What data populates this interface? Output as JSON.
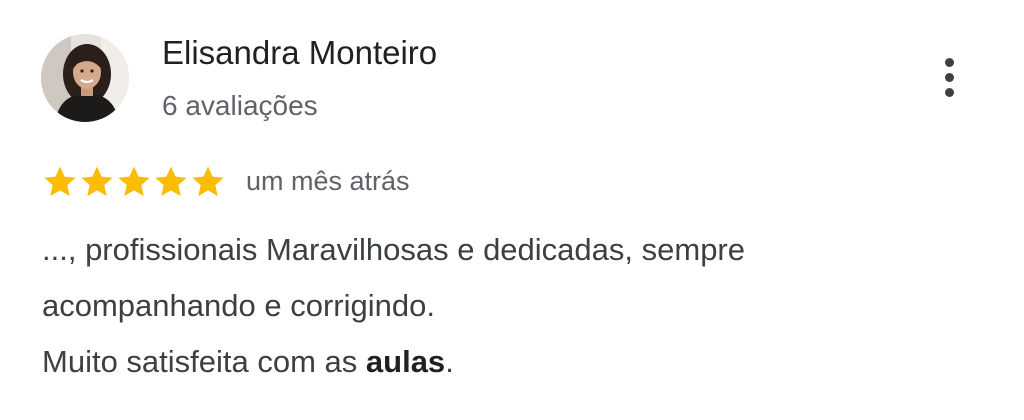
{
  "review": {
    "author_name": "Elisandra Monteiro",
    "review_count": "6 avaliações",
    "rating": 5,
    "rating_max": 5,
    "date": "um mês atrás",
    "text": {
      "line1": "..., profissionais Maravilhosas e dedicadas, sempre",
      "line2": "acompanhando e corrigindo.",
      "line3_prefix": "Muito satisfeita com as ",
      "line3_bold": "aulas",
      "line3_suffix": "."
    }
  },
  "icons": {
    "avatar": "profile-photo",
    "menu": "more-vert-icon",
    "star": "star-icon"
  },
  "colors": {
    "star": "#fbbc04",
    "name": "#202124",
    "secondary": "#5f6368",
    "body": "#3c4043"
  }
}
